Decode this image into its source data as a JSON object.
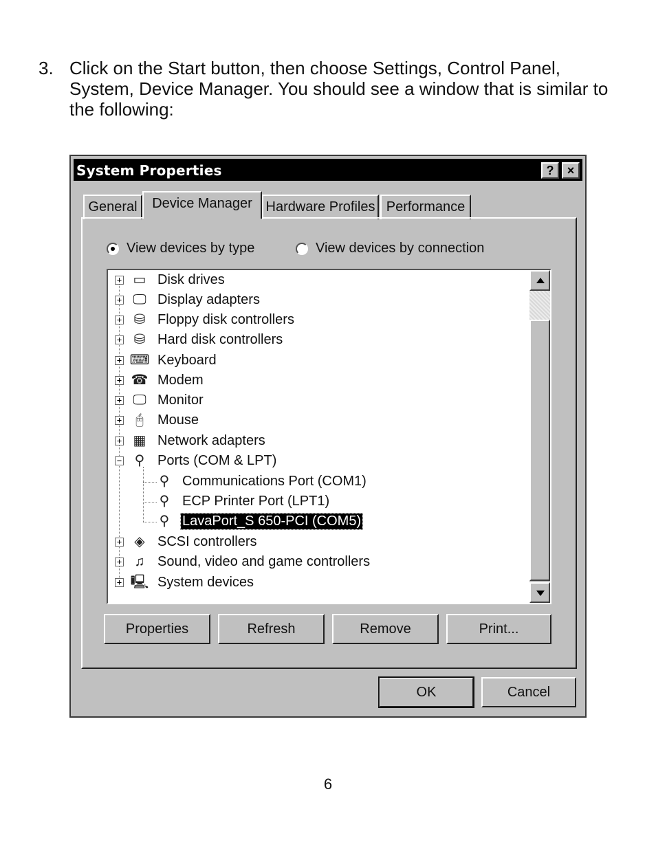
{
  "document": {
    "step_number": "3.",
    "instruction_lines": [
      "Click on the Start button, then choose Settings, Control Panel,",
      "System, Device Manager. You should see a window that is similar to",
      "the following:"
    ],
    "page_number": "6"
  },
  "window": {
    "title": "System Properties",
    "help_button": "?",
    "close_button": "×"
  },
  "tabs": [
    {
      "label": "General"
    },
    {
      "label": "Device Manager"
    },
    {
      "label": "Hardware Profiles"
    },
    {
      "label": "Performance"
    }
  ],
  "view_options": {
    "by_type": "View devices by type",
    "by_connection": "View devices by connection",
    "selected": "by_type"
  },
  "tree": {
    "items": [
      {
        "label": "Disk drives",
        "icon": "disk-drive-icon",
        "glyph": "▭"
      },
      {
        "label": "Display adapters",
        "icon": "display-adapter-icon",
        "glyph": "🖵"
      },
      {
        "label": "Floppy disk controllers",
        "icon": "floppy-controller-icon",
        "glyph": "⛁"
      },
      {
        "label": "Hard disk controllers",
        "icon": "hard-disk-controller-icon",
        "glyph": "⛁"
      },
      {
        "label": "Keyboard",
        "icon": "keyboard-icon",
        "glyph": "⌨"
      },
      {
        "label": "Modem",
        "icon": "modem-icon",
        "glyph": "☎"
      },
      {
        "label": "Monitor",
        "icon": "monitor-icon",
        "glyph": "🖵"
      },
      {
        "label": "Mouse",
        "icon": "mouse-icon",
        "glyph": "🖰"
      },
      {
        "label": "Network adapters",
        "icon": "network-adapter-icon",
        "glyph": "▦"
      },
      {
        "label": "Ports (COM & LPT)",
        "icon": "port-plug-icon",
        "glyph": "⚲"
      },
      {
        "label": "Communications Port (COM1)",
        "icon": "port-plug-icon",
        "glyph": "⚲"
      },
      {
        "label": "ECP Printer Port (LPT1)",
        "icon": "port-plug-icon",
        "glyph": "⚲"
      },
      {
        "label": "LavaPort_S 650-PCI (COM5)",
        "icon": "port-plug-icon",
        "glyph": "⚲"
      },
      {
        "label": "SCSI controllers",
        "icon": "scsi-controller-icon",
        "glyph": "◈"
      },
      {
        "label": "Sound, video and game controllers",
        "icon": "sound-controller-icon",
        "glyph": "♫"
      },
      {
        "label": "System devices",
        "icon": "system-devices-icon",
        "glyph": "🖳"
      }
    ],
    "selected_item": "LavaPort_S 650-PCI (COM5)"
  },
  "buttons": {
    "properties": "Properties",
    "refresh": "Refresh",
    "remove": "Remove",
    "print": "Print...",
    "ok": "OK",
    "cancel": "Cancel"
  }
}
